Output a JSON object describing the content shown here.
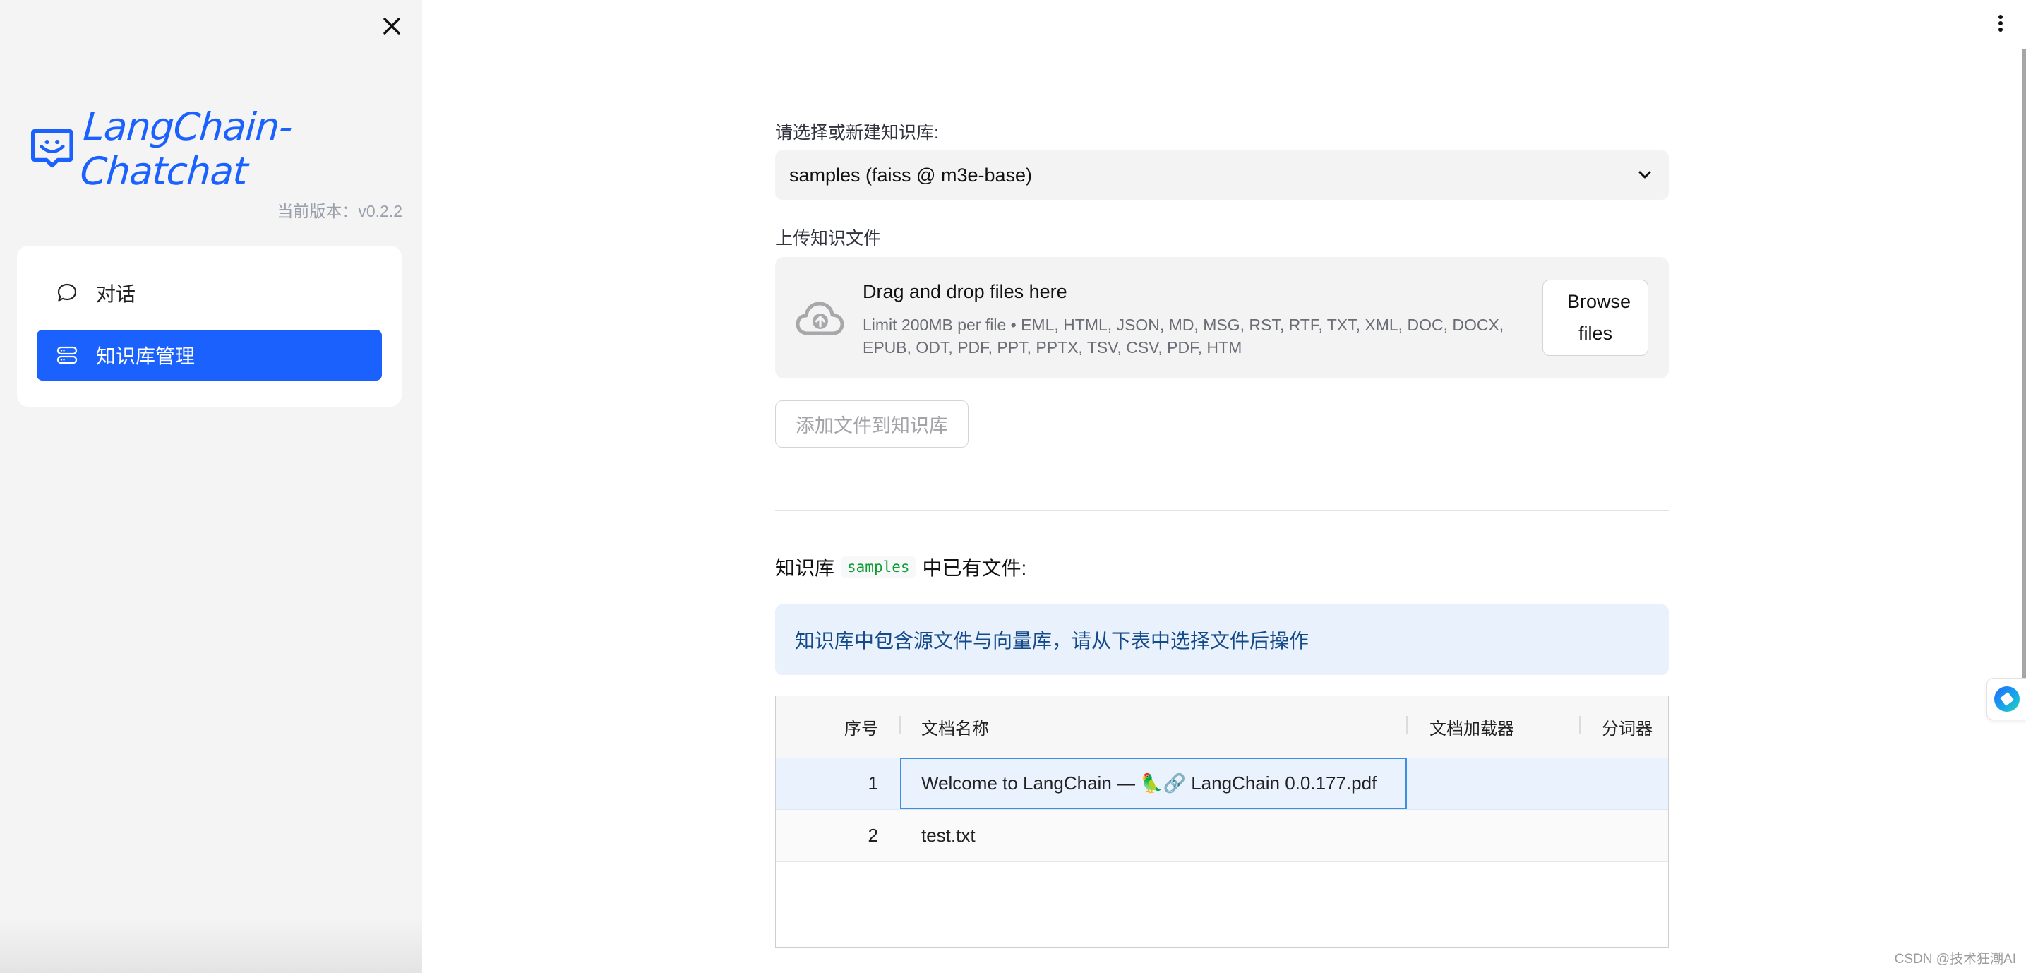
{
  "sidebar": {
    "close_icon": "close-icon",
    "logo_text": "LangChain-Chatchat",
    "logo_icon": "smiley-chat-bubble-icon",
    "version": "当前版本：v0.2.2",
    "nav_items": [
      {
        "label": "对话",
        "icon": "chat-bubble-icon",
        "active": false
      },
      {
        "label": "知识库管理",
        "icon": "database-icon",
        "active": true
      }
    ],
    "accent_color": "#1a61fe"
  },
  "main": {
    "kb_select": {
      "label": "请选择或新建知识库:",
      "value": "samples (faiss @ m3e-base)"
    },
    "uploader": {
      "label": "上传知识文件",
      "title": "Drag and drop files here",
      "limit": "Limit 200MB per file • EML, HTML, JSON, MD, MSG, RST, RTF, TXT, XML, DOC, DOCX, EPUB, ODT, PDF, PPT, PPTX, TSV, CSV, PDF, HTM",
      "browse_label": "Browse files"
    },
    "add_button_label": "添加文件到知识库",
    "existing": {
      "prefix": "知识库",
      "kb_name": "samples",
      "suffix": "中已有文件:"
    },
    "info_text": "知识库中包含源文件与向量库，请从下表中选择文件后操作",
    "table": {
      "columns": [
        "序号",
        "文档名称",
        "文档加载器",
        "分词器"
      ],
      "rows": [
        {
          "index": "1",
          "name": "Welcome to LangChain — 🦜🔗 LangChain 0.0.177.pdf",
          "loader": "",
          "tokenizer": "",
          "selected": true
        },
        {
          "index": "2",
          "name": "test.txt",
          "loader": "",
          "tokenizer": "",
          "selected": false
        }
      ]
    }
  },
  "watermark": "CSDN @技术狂潮AI"
}
